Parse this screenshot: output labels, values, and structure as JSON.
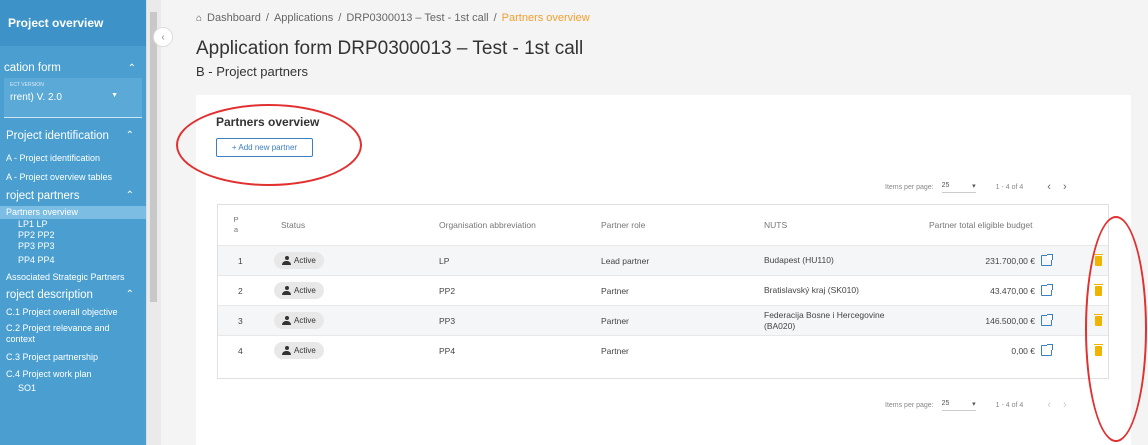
{
  "sidebar": {
    "top": "Project overview",
    "app_form": "cation form",
    "version_label": "ECT VERSION",
    "version_value": "rrent) V. 2.0",
    "sec_identification": "Project identification",
    "item_a": "A - Project identification",
    "item_a_tables": "A - Project overview tables",
    "sec_partners": "roject partners",
    "item_partners_overview": "Partners overview",
    "lp1": "LP1 LP",
    "pp2": "PP2 PP2",
    "pp3": "PP3 PP3",
    "pp4": "PP4 PP4",
    "associated": "Associated Strategic Partners",
    "sec_description": "roject description",
    "c1": "C.1 Project overall objective",
    "c2a": "C.2 Project relevance and",
    "c2b": "context",
    "c3": "C.3 Project partnership",
    "c4": "C.4 Project work plan",
    "so1": "SO1"
  },
  "breadcrumb": {
    "dashboard": "Dashboard",
    "applications": "Applications",
    "application": "DRP0300013 – Test - 1st call",
    "current": "Partners overview",
    "sep": "/"
  },
  "title": "Application form DRP0300013 – Test - 1st call",
  "subtitle": "B - Project partners",
  "card": {
    "title": "Partners overview",
    "add_button": "+ Add new partner"
  },
  "pagination": {
    "items_label": "Items per page:",
    "per_page": "25",
    "range": "1 - 4 of 4"
  },
  "table": {
    "headers": {
      "pa": "P a",
      "status": "Status",
      "org": "Organisation abbreviation",
      "role": "Partner role",
      "nuts": "NUTS",
      "budget": "Partner total eligible budget"
    },
    "rows": [
      {
        "n": "1",
        "status": "Active",
        "org": "LP",
        "role": "Lead partner",
        "nuts": "Budapest (HU110)",
        "budget": "231.700,00 €"
      },
      {
        "n": "2",
        "status": "Active",
        "org": "PP2",
        "role": "Partner",
        "nuts": "Bratislavský kraj (SK010)",
        "budget": "43.470,00 €"
      },
      {
        "n": "3",
        "status": "Active",
        "org": "PP3",
        "role": "Partner",
        "nuts": "Federacija Bosne i Hercegovine (BA020)",
        "budget": "146.500,00 €"
      },
      {
        "n": "4",
        "status": "Active",
        "org": "PP4",
        "role": "Partner",
        "nuts": "",
        "budget": "0,00 €"
      }
    ]
  },
  "colors": {
    "sidebar": "#4a9fd0",
    "accent": "#3d7ebd",
    "breadcrumb_current": "#f0a030",
    "delete": "#f0b400",
    "annotation": "#e03030"
  }
}
